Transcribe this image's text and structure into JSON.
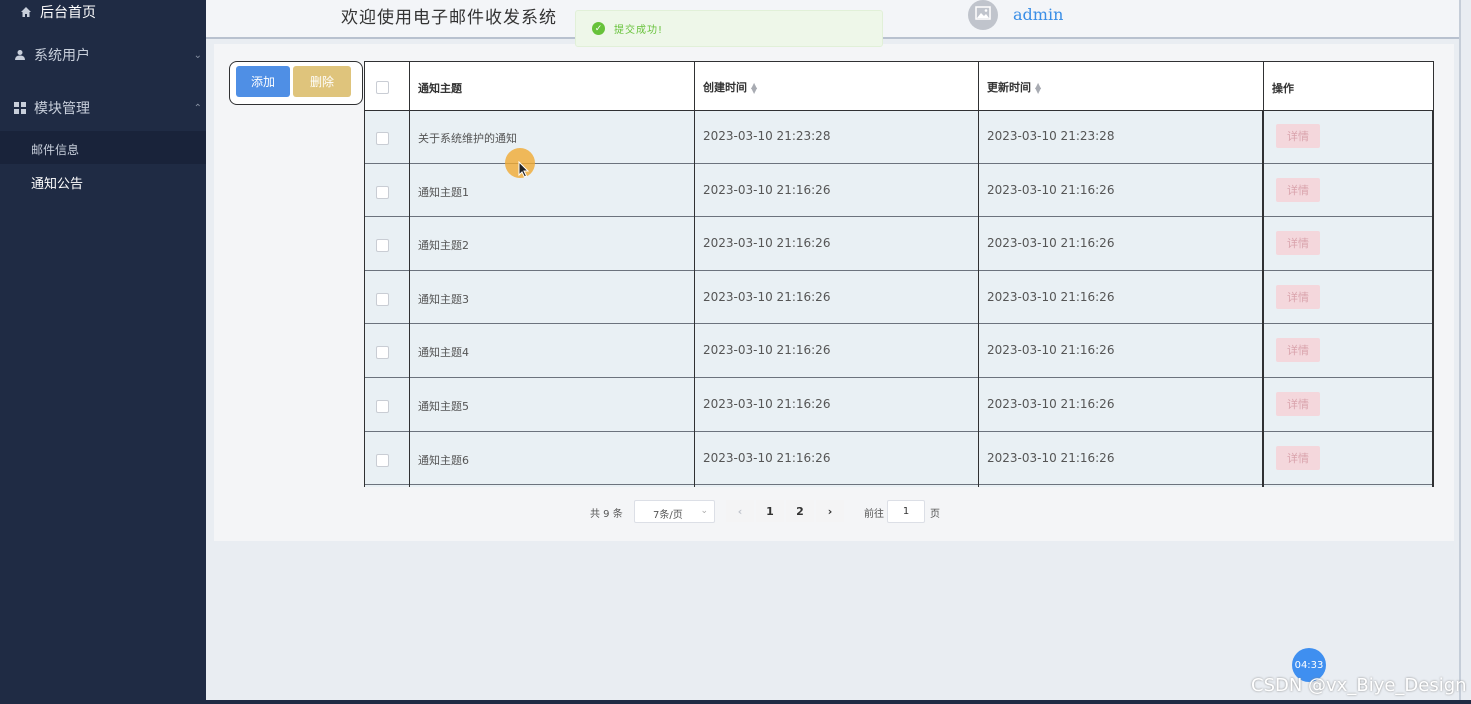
{
  "sidebar": {
    "home": "后台首页",
    "users": "系统用户",
    "modules": "模块管理",
    "sub_mail": "邮件信息",
    "sub_notice": "通知公告"
  },
  "header": {
    "welcome": "欢迎使用电子邮件收发系统",
    "username": "admin"
  },
  "toast": {
    "message": "提交成功!"
  },
  "toolbar": {
    "add_label": "添加",
    "delete_label": "删除"
  },
  "table": {
    "headers": {
      "subject": "通知主题",
      "created": "创建时间",
      "updated": "更新时间",
      "actions": "操作"
    },
    "detail_label": "详情",
    "rows": [
      {
        "subject": "关于系统维护的通知",
        "created": "2023-03-10 21:23:28",
        "updated": "2023-03-10 21:23:28"
      },
      {
        "subject": "通知主题1",
        "created": "2023-03-10 21:16:26",
        "updated": "2023-03-10 21:16:26"
      },
      {
        "subject": "通知主题2",
        "created": "2023-03-10 21:16:26",
        "updated": "2023-03-10 21:16:26"
      },
      {
        "subject": "通知主题3",
        "created": "2023-03-10 21:16:26",
        "updated": "2023-03-10 21:16:26"
      },
      {
        "subject": "通知主题4",
        "created": "2023-03-10 21:16:26",
        "updated": "2023-03-10 21:16:26"
      },
      {
        "subject": "通知主题5",
        "created": "2023-03-10 21:16:26",
        "updated": "2023-03-10 21:16:26"
      },
      {
        "subject": "通知主题6",
        "created": "2023-03-10 21:16:26",
        "updated": "2023-03-10 21:16:26"
      }
    ]
  },
  "pager": {
    "total": "共 9 条",
    "page_size": "7条/页",
    "pages": [
      "1",
      "2"
    ],
    "goto_label": "前往",
    "goto_value": "1",
    "goto_suffix": "页"
  },
  "overlay": {
    "timer": "04:33",
    "watermark": "CSDN @vx_Biye_Design"
  },
  "colors": {
    "sidebar_bg": "#1f2b44",
    "primary": "#4f8fe5",
    "warning": "#dfc47c",
    "success": "#67c23a",
    "detail_bg": "#f4d7dc"
  }
}
